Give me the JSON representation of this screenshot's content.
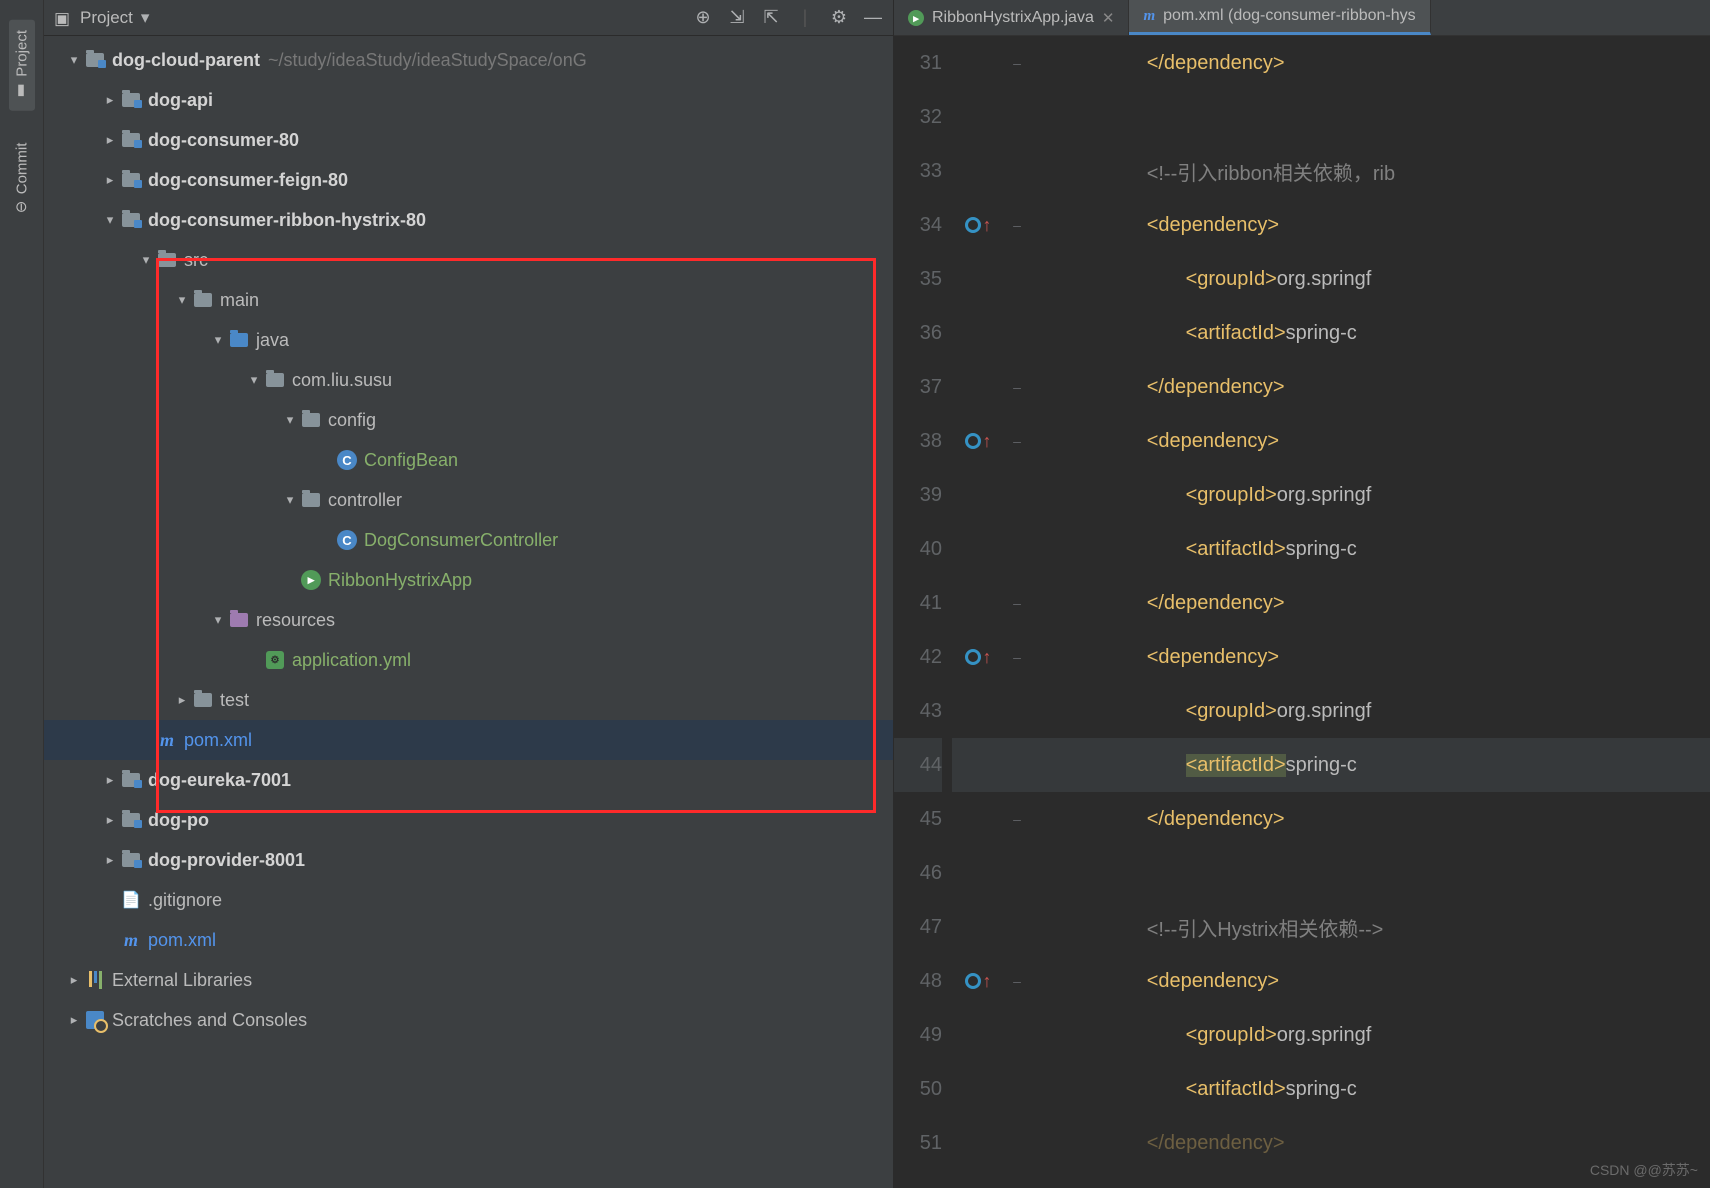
{
  "sideTabs": {
    "project": "Project",
    "commit": "Commit"
  },
  "panel": {
    "title": "Project"
  },
  "tree": {
    "root": {
      "name": "dog-cloud-parent",
      "path": "~/study/ideaStudy/ideaStudySpace/onG"
    },
    "items": [
      {
        "name": "dog-api"
      },
      {
        "name": "dog-consumer-80"
      },
      {
        "name": "dog-consumer-feign-80"
      },
      {
        "name": "dog-consumer-ribbon-hystrix-80"
      },
      {
        "name": "src"
      },
      {
        "name": "main"
      },
      {
        "name": "java"
      },
      {
        "name": "com.liu.susu"
      },
      {
        "name": "config"
      },
      {
        "name": "ConfigBean"
      },
      {
        "name": "controller"
      },
      {
        "name": "DogConsumerController"
      },
      {
        "name": "RibbonHystrixApp"
      },
      {
        "name": "resources"
      },
      {
        "name": "application.yml"
      },
      {
        "name": "test"
      },
      {
        "name": "pom.xml"
      },
      {
        "name": "dog-eureka-7001"
      },
      {
        "name": "dog-po"
      },
      {
        "name": "dog-provider-8001"
      },
      {
        "name": ".gitignore"
      },
      {
        "name": "pom.xml"
      },
      {
        "name": "External Libraries"
      },
      {
        "name": "Scratches and Consoles"
      }
    ]
  },
  "editorTabs": [
    {
      "label": "RibbonHystrixApp.java",
      "active": false
    },
    {
      "label": "pom.xml (dog-consumer-ribbon-hys",
      "active": true
    }
  ],
  "code": {
    "startLine": 31,
    "lines": [
      {
        "n": 31,
        "html": "</dependency>",
        "fold": "–",
        "type": "tag",
        "indent": 3
      },
      {
        "n": 32,
        "html": ""
      },
      {
        "n": 33,
        "html": "<!--引入ribbon相关依赖，rib",
        "type": "comm",
        "indent": 3
      },
      {
        "n": 34,
        "html": "<dependency>",
        "mark": true,
        "fold": "–",
        "type": "tag",
        "indent": 3
      },
      {
        "n": 35,
        "html": "<groupId>org.springf",
        "type": "tag-text",
        "indent": 4
      },
      {
        "n": 36,
        "html": "<artifactId>spring-c",
        "type": "tag-text",
        "indent": 4
      },
      {
        "n": 37,
        "html": "</dependency>",
        "fold": "–",
        "type": "tag",
        "indent": 3
      },
      {
        "n": 38,
        "html": "<dependency>",
        "mark": true,
        "fold": "–",
        "type": "tag",
        "indent": 3
      },
      {
        "n": 39,
        "html": "<groupId>org.springf",
        "type": "tag-text",
        "indent": 4
      },
      {
        "n": 40,
        "html": "<artifactId>spring-c",
        "type": "tag-text",
        "indent": 4
      },
      {
        "n": 41,
        "html": "</dependency>",
        "fold": "–",
        "type": "tag",
        "indent": 3
      },
      {
        "n": 42,
        "html": "<dependency>",
        "mark": true,
        "fold": "–",
        "type": "tag",
        "indent": 3
      },
      {
        "n": 43,
        "html": "<groupId>org.springf",
        "type": "tag-text",
        "indent": 4
      },
      {
        "n": 44,
        "html": "<artifactId>spring-c",
        "type": "tag-text-hl",
        "indent": 4,
        "hl": true
      },
      {
        "n": 45,
        "html": "</dependency>",
        "fold": "–",
        "type": "tag",
        "indent": 3
      },
      {
        "n": 46,
        "html": ""
      },
      {
        "n": 47,
        "html": "<!--引入Hystrix相关依赖-->",
        "type": "comm",
        "indent": 3
      },
      {
        "n": 48,
        "html": "<dependency>",
        "mark": true,
        "fold": "–",
        "type": "tag",
        "indent": 3
      },
      {
        "n": 49,
        "html": "<groupId>org.springf",
        "type": "tag-text",
        "indent": 4
      },
      {
        "n": 50,
        "html": "<artifactId>spring-c",
        "type": "tag-text",
        "indent": 4
      },
      {
        "n": 51,
        "html": "</dependency>",
        "type": "tag",
        "indent": 3,
        "dim": true
      }
    ]
  },
  "watermark": "CSDN @@苏苏~"
}
